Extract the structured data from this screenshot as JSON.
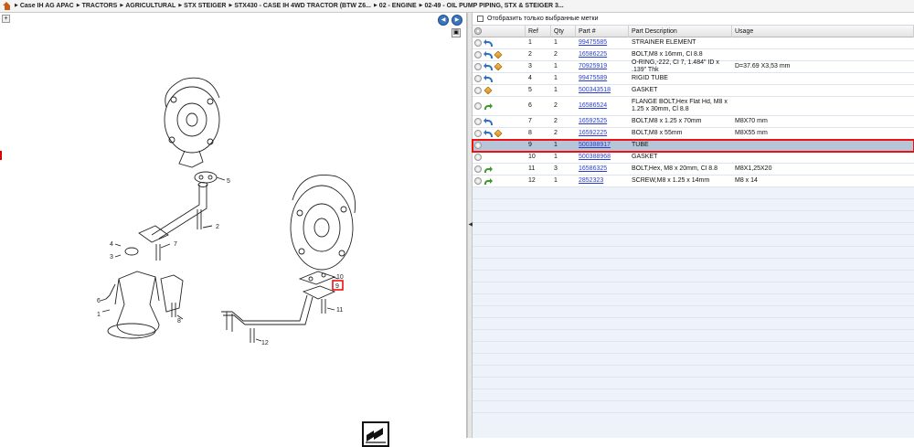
{
  "breadcrumb": [
    "Case IH AG APAC",
    "TRACTORS",
    "AGRICULTURAL",
    "STX STEIGER",
    "STX430 - CASE IH 4WD TRACTOR (BTW Z6...",
    "02 - ENGINE",
    "02-49 - OIL PUMP PIPING, STX & STEIGER 3..."
  ],
  "filter": {
    "label": "Отобразить только выбранные метки",
    "checked": false
  },
  "columns": {
    "ref": "Ref",
    "qty": "Qty",
    "part": "Part #",
    "description": "Part Description",
    "usage": "Usage"
  },
  "parts": [
    {
      "ref": "1",
      "qty": "1",
      "part": "99475585",
      "description": "STRAINER ELEMENT",
      "usage": "",
      "icons": [
        "circle",
        "blue"
      ]
    },
    {
      "ref": "2",
      "qty": "2",
      "part": "16586225",
      "description": "BOLT,M8 x 16mm, Cl 8.8",
      "usage": "",
      "icons": [
        "circle",
        "blue",
        "cube"
      ]
    },
    {
      "ref": "3",
      "qty": "1",
      "part": "70925919",
      "description": "O-RING,-222, Cl 7, 1.484\" ID x .139\" Thk",
      "usage": "D=37.69 X3,53 mm",
      "icons": [
        "circle",
        "blue",
        "cube"
      ]
    },
    {
      "ref": "4",
      "qty": "1",
      "part": "99475589",
      "description": "RIGID TUBE",
      "usage": "",
      "icons": [
        "circle",
        "blue"
      ]
    },
    {
      "ref": "5",
      "qty": "1",
      "part": "500343518",
      "description": "GASKET",
      "usage": "",
      "icons": [
        "circle",
        "cube"
      ]
    },
    {
      "ref": "6",
      "qty": "2",
      "part": "16586524",
      "description": "FLANGE BOLT,Hex Flat Hd, M8 x 1.25 x 30mm, Cl 8.8",
      "usage": "",
      "icons": [
        "circle",
        "green"
      ],
      "tall": true
    },
    {
      "ref": "7",
      "qty": "2",
      "part": "16592525",
      "description": "BOLT,M8 x 1.25 x 70mm",
      "usage": "M8X70 mm",
      "icons": [
        "circle",
        "blue"
      ]
    },
    {
      "ref": "8",
      "qty": "2",
      "part": "16592225",
      "description": "BOLT,M8 x 55mm",
      "usage": "M8X55 mm",
      "icons": [
        "circle",
        "blue",
        "cube"
      ]
    },
    {
      "ref": "9",
      "qty": "1",
      "part": "500388917",
      "description": "TUBE",
      "usage": "",
      "icons": [
        "circle"
      ],
      "selected": true
    },
    {
      "ref": "10",
      "qty": "1",
      "part": "500388968",
      "description": "GASKET",
      "usage": "",
      "icons": [
        "circle"
      ]
    },
    {
      "ref": "11",
      "qty": "3",
      "part": "16586325",
      "description": "BOLT,Hex, M8 x 20mm, Cl 8.8",
      "usage": "M8X1,25X20",
      "icons": [
        "circle",
        "green"
      ]
    },
    {
      "ref": "12",
      "qty": "1",
      "part": "2852323",
      "description": "SCREW,M8 x 1.25  x 14mm",
      "usage": "M8 x 14",
      "icons": [
        "circle",
        "green"
      ]
    }
  ],
  "callouts": [
    "1",
    "2",
    "3",
    "4",
    "5",
    "6",
    "7",
    "8",
    "9",
    "10",
    "11",
    "12"
  ],
  "empty_rows": 19
}
